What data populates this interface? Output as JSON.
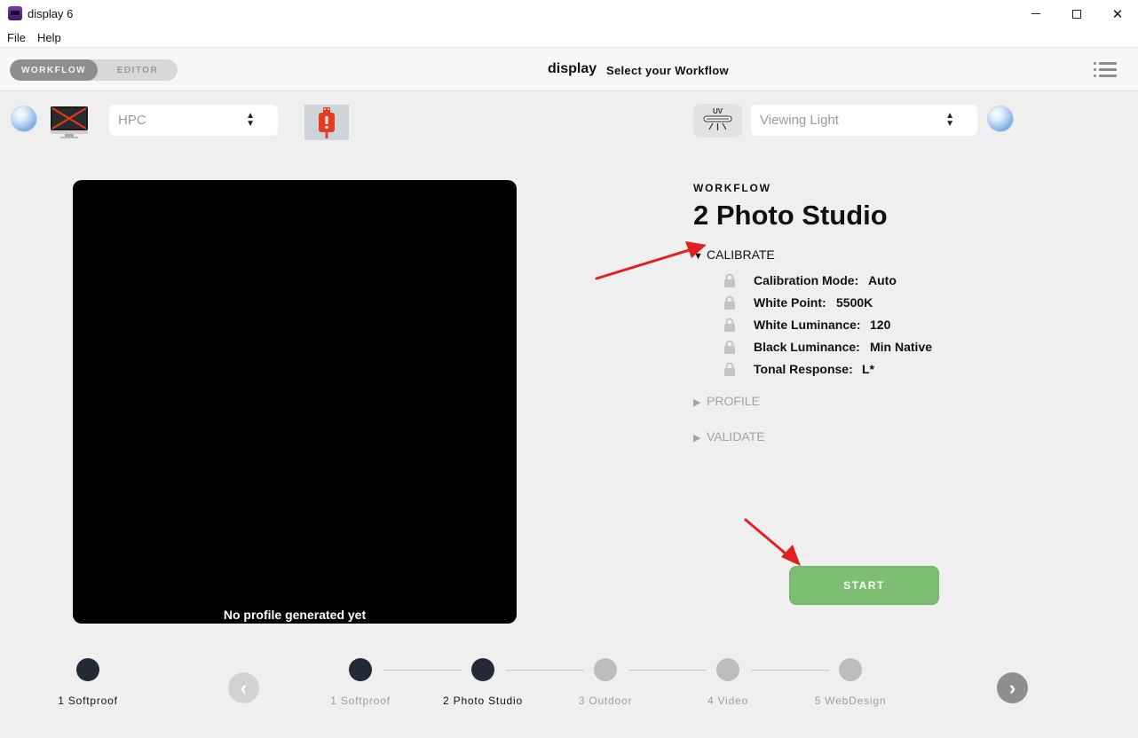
{
  "window": {
    "title": "display 6",
    "minimize": "—",
    "maximize": "□",
    "close": "✕"
  },
  "menubar": {
    "file": "File",
    "help": "Help"
  },
  "header": {
    "mode_workflow": "WORKFLOW",
    "mode_editor": "EDITOR",
    "brand": "display",
    "subtitle": "Select your Workflow"
  },
  "devices": {
    "display_select": {
      "value": "HPC"
    },
    "viewing_light_select": {
      "value": "Viewing Light"
    },
    "uv_label": "UV"
  },
  "preview": {
    "caption": "No profile generated yet"
  },
  "workflow": {
    "section_label": "WORKFLOW",
    "title": "2 Photo Studio",
    "calibrate": {
      "label": "CALIBRATE",
      "expanded": true,
      "settings": [
        {
          "key": "Calibration Mode:",
          "value": "Auto"
        },
        {
          "key": "White Point:",
          "value": "5500K"
        },
        {
          "key": "White Luminance:",
          "value": "120"
        },
        {
          "key": "Black Luminance:",
          "value": "Min Native"
        },
        {
          "key": "Tonal Response:",
          "value": "L*"
        }
      ]
    },
    "profile": {
      "label": "PROFILE",
      "expanded": false
    },
    "validate": {
      "label": "VALIDATE",
      "expanded": false
    },
    "start_label": "START"
  },
  "steps": {
    "current": "1 Softproof",
    "prev": "‹",
    "next": "›",
    "items": [
      {
        "label": "1 Softproof",
        "active": true
      },
      {
        "label": "2 Photo Studio",
        "active": true
      },
      {
        "label": "3 Outdoor",
        "active": false
      },
      {
        "label": "4 Video",
        "active": false
      },
      {
        "label": "5 WebDesign",
        "active": false
      }
    ]
  },
  "colors": {
    "accent_start": "#7dbf72",
    "step_active": "#232a36",
    "step_inactive": "#bdbdbd",
    "usb_alert": "#e8391e",
    "annotation_arrow": "#e02020"
  }
}
